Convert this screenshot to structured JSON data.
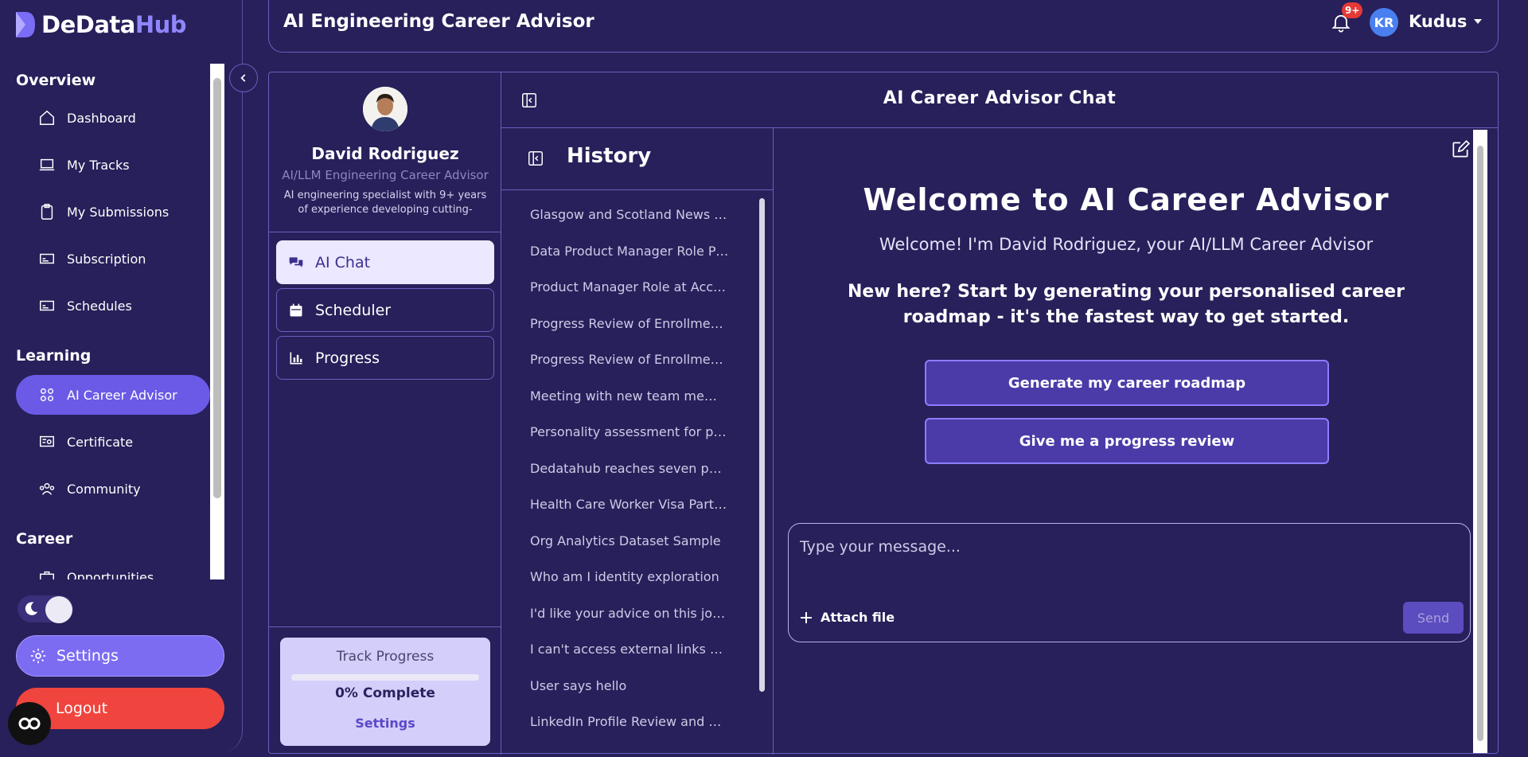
{
  "brand": {
    "name_part1": "DeData",
    "name_part2": "Hub"
  },
  "sidebar": {
    "sections": [
      {
        "title": "Overview"
      },
      {
        "title": "Learning"
      },
      {
        "title": "Career"
      }
    ],
    "items": [
      {
        "label": "Dashboard",
        "icon": "home-icon"
      },
      {
        "label": "My Tracks",
        "icon": "laptop-icon"
      },
      {
        "label": "My Submissions",
        "icon": "clipboard-icon"
      },
      {
        "label": "Subscription",
        "icon": "card-icon"
      },
      {
        "label": "Schedules",
        "icon": "card-icon"
      },
      {
        "label": "AI Career Advisor",
        "icon": "grid-icon",
        "active": true
      },
      {
        "label": "Certificate",
        "icon": "certificate-icon"
      },
      {
        "label": "Community",
        "icon": "community-icon"
      },
      {
        "label": "Opportunities",
        "icon": "briefcase-icon"
      }
    ],
    "settings_label": "Settings",
    "logout_label": "Logout"
  },
  "header": {
    "title": "AI Engineering Career Advisor",
    "notification_badge": "9+",
    "user_initials": "KR",
    "user_name": "Kudus"
  },
  "advisor": {
    "name": "David Rodriguez",
    "role": "AI/LLM Engineering Career Advisor",
    "description": "AI engineering specialist with 9+ years of experience developing cutting-edge..."
  },
  "advisor_menu": [
    {
      "label": "AI Chat",
      "active": true
    },
    {
      "label": "Scheduler"
    },
    {
      "label": "Progress"
    }
  ],
  "track_progress": {
    "title": "Track Progress",
    "percent_value": 0,
    "percent_label": "0% Complete",
    "settings_label": "Settings"
  },
  "chat": {
    "title": "AI Career Advisor Chat",
    "welcome_title": "Welcome to AI Career Advisor",
    "welcome_sub": "Welcome! I'm David Rodriguez, your AI/LLM Career Advisor",
    "welcome_new": "New here? Start by generating your personalised career roadmap - it's the fastest way to get started.",
    "buttons": [
      "Generate my career roadmap",
      "Give me a progress review"
    ],
    "input_placeholder": "Type your message...",
    "attach_label": "Attach file",
    "send_label": "Send"
  },
  "history": {
    "title": "History",
    "items": [
      "Glasgow and Scotland News Today",
      "Data Product Manager Role Preparation",
      "Product Manager Role at Accenture",
      "Progress Review of Enrollment Tracks",
      "Progress Review of Enrollment Status",
      "Meeting with new team members",
      "Personality assessment for professionals",
      "Dedatahub reaches seven partners",
      "Health Care Worker Visa Partnership",
      "Org Analytics Dataset Sample",
      "Who am I identity exploration",
      "I'd like your advice on this job offer",
      "I can't access external links or files",
      "User says hello",
      "LinkedIn Profile Review and Optimization"
    ]
  }
}
